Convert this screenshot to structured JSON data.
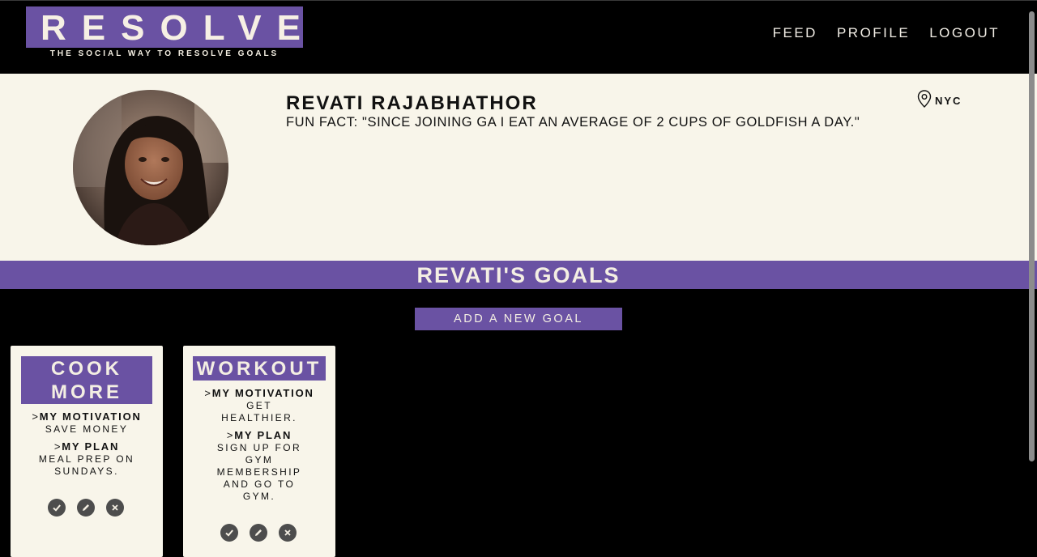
{
  "header": {
    "logo": "RESOLVE",
    "tagline": "THE SOCIAL WAY TO RESOLVE GOALS",
    "nav": [
      "FEED",
      "PROFILE",
      "LOGOUT"
    ]
  },
  "profile": {
    "name": "REVATI RAJABHATHOR",
    "fun_fact": "FUN FACT: \"SINCE JOINING GA I EAT AN AVERAGE OF 2 CUPS OF GOLDFISH A DAY.\"",
    "location": "NYC",
    "location_icon": "map-pin-icon"
  },
  "goals_section": {
    "title": "REVATI'S GOALS",
    "add_button": "ADD A NEW GOAL"
  },
  "goals": [
    {
      "title_lines": [
        "COOK",
        "MORE"
      ],
      "motivation_label": "MY MOTIVATION",
      "motivation": "SAVE MONEY",
      "plan_label": "MY PLAN",
      "plan_lines": [
        "MEAL PREP ON",
        "SUNDAYS."
      ]
    },
    {
      "title_lines": [
        "WORKOUT"
      ],
      "motivation_label": "MY MOTIVATION",
      "motivation_lines": [
        "GET",
        "HEALTHIER."
      ],
      "plan_label": "MY PLAN",
      "plan_lines": [
        "SIGN UP FOR",
        "GYM",
        "MEMBERSHIP",
        "AND GO TO",
        "GYM."
      ]
    }
  ],
  "colors": {
    "accent": "#6a52a3",
    "cream": "#f8f5ea",
    "background": "#000000",
    "icon": "#4d4d4d"
  },
  "caret": ">"
}
